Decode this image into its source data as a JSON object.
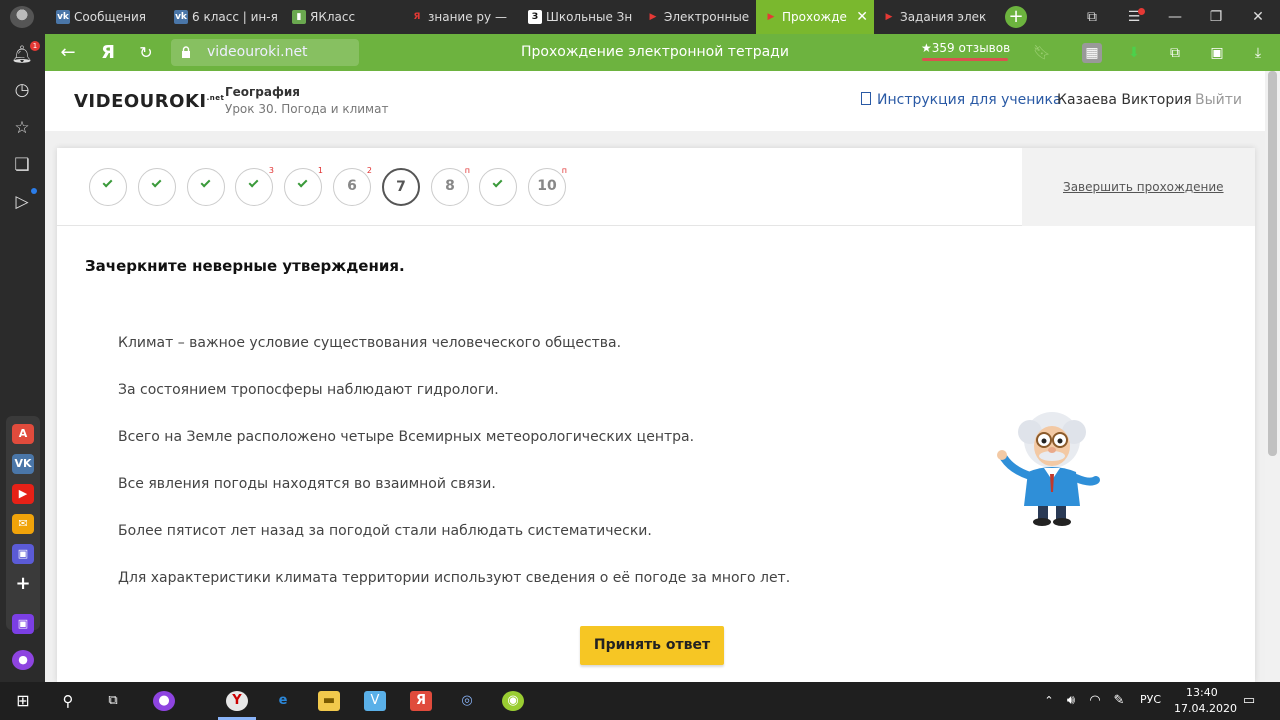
{
  "colors": {
    "browser_green": "#6db33f",
    "active_tab": "#7ab82e",
    "accent_button": "#f6c624",
    "link_blue": "#2a5aa5",
    "check_green": "#3a9a3a",
    "badge_red": "#e03030"
  },
  "tabs": [
    {
      "label": "Сообщения",
      "icon": "vk-icon",
      "active": false
    },
    {
      "label": "6 класс | ин-я",
      "icon": "vk-icon",
      "active": false
    },
    {
      "label": "ЯКласс",
      "icon": "yaklass-icon",
      "active": false
    },
    {
      "label": "знание ру —",
      "icon": "yandex-icon",
      "active": false
    },
    {
      "label": "Школьные Зн",
      "icon": "znanija-icon",
      "active": false
    },
    {
      "label": "Электронные",
      "icon": "videouroki-icon",
      "active": false
    },
    {
      "label": "Прохожде",
      "icon": "videouroki-icon",
      "active": true
    },
    {
      "label": "Задания элек",
      "icon": "videouroki-icon",
      "active": false
    }
  ],
  "sidebar": {
    "notification_count": "1"
  },
  "addressbar": {
    "url": "videouroki.net",
    "page_title": "Прохождение электронной тетради",
    "reviews": "★359 отзывов"
  },
  "header": {
    "logo": "VIDEOUROKI",
    "logo_suffix": ".net",
    "subject": "География",
    "lesson": "Урок 30. Погода и климат",
    "instruction_link": "Инструкция для ученика",
    "user_name": "Казаева Виктория",
    "logout": "Выйти"
  },
  "progress": {
    "steps": [
      {
        "label": "",
        "state": "done",
        "badge": ""
      },
      {
        "label": "",
        "state": "done",
        "badge": ""
      },
      {
        "label": "",
        "state": "done",
        "badge": ""
      },
      {
        "label": "",
        "state": "done",
        "badge": "3"
      },
      {
        "label": "",
        "state": "done",
        "badge": "1"
      },
      {
        "label": "6",
        "state": "pending",
        "badge": "2"
      },
      {
        "label": "7",
        "state": "current",
        "badge": ""
      },
      {
        "label": "8",
        "state": "pending",
        "badge": "п"
      },
      {
        "label": "",
        "state": "done",
        "badge": ""
      },
      {
        "label": "10",
        "state": "pending",
        "badge": "п"
      }
    ],
    "finish_label": "Завершить прохождение"
  },
  "task": {
    "title": "Зачеркните неверные утверждения.",
    "statements": [
      "Климат – важное условие существования человеческого общества.",
      "За состоянием тропосферы наблюдают гидрологи.",
      "Всего на Земле расположено четыре Всемирных метеорологических центра.",
      "Все явления погоды находятся во взаимной связи.",
      "Более пятисот лет назад за погодой стали наблюдать систематически.",
      "Для характеристики климата территории используют сведения о её погоде за много лет."
    ],
    "submit_label": "Принять ответ"
  },
  "taskbar": {
    "language": "РУС",
    "time": "13:40",
    "date": "17.04.2020"
  }
}
